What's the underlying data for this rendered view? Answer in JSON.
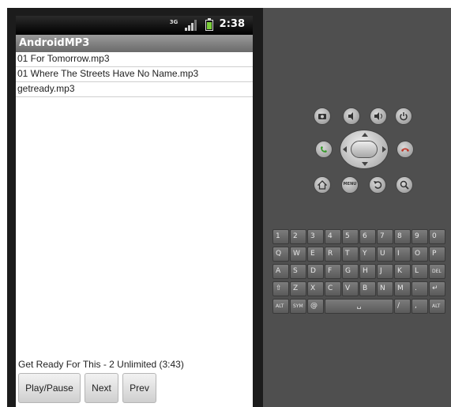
{
  "status_bar": {
    "network": "3G",
    "time": "2:38"
  },
  "app": {
    "title": "AndroidMP3",
    "songs": [
      "01 For Tomorrow.mp3",
      "01 Where The Streets Have No Name.mp3",
      "getready.mp3"
    ],
    "now_playing": "Get Ready For This - 2 Unlimited (3:43)",
    "buttons": {
      "play_pause": "Play/Pause",
      "next": "Next",
      "prev": "Prev"
    }
  },
  "hardware_buttons": [
    "camera-icon",
    "volume-down-icon",
    "volume-up-icon",
    "power-icon",
    "call-icon",
    "end-call-icon",
    "home-icon",
    "menu-icon",
    "back-icon",
    "search-icon"
  ],
  "menu_label": "MENU",
  "keyboard": {
    "rows": [
      [
        "1",
        "2",
        "3",
        "4",
        "5",
        "6",
        "7",
        "8",
        "9",
        "0"
      ],
      [
        "Q",
        "W",
        "E",
        "R",
        "T",
        "Y",
        "U",
        "I",
        "O",
        "P"
      ],
      [
        "A",
        "S",
        "D",
        "F",
        "G",
        "H",
        "J",
        "K",
        "L",
        "DEL"
      ],
      [
        "⇧",
        "Z",
        "X",
        "C",
        "V",
        "B",
        "N",
        "M",
        ".",
        "↵"
      ],
      [
        "ALT",
        "SYM",
        "@",
        "␣",
        "/",
        ",",
        "ALT"
      ]
    ]
  },
  "colors": {
    "call_green": "#3a9a2e",
    "end_red": "#c0392b",
    "title_bar": "#7a7a7a",
    "emulator_bg": "#4f4f4f"
  }
}
